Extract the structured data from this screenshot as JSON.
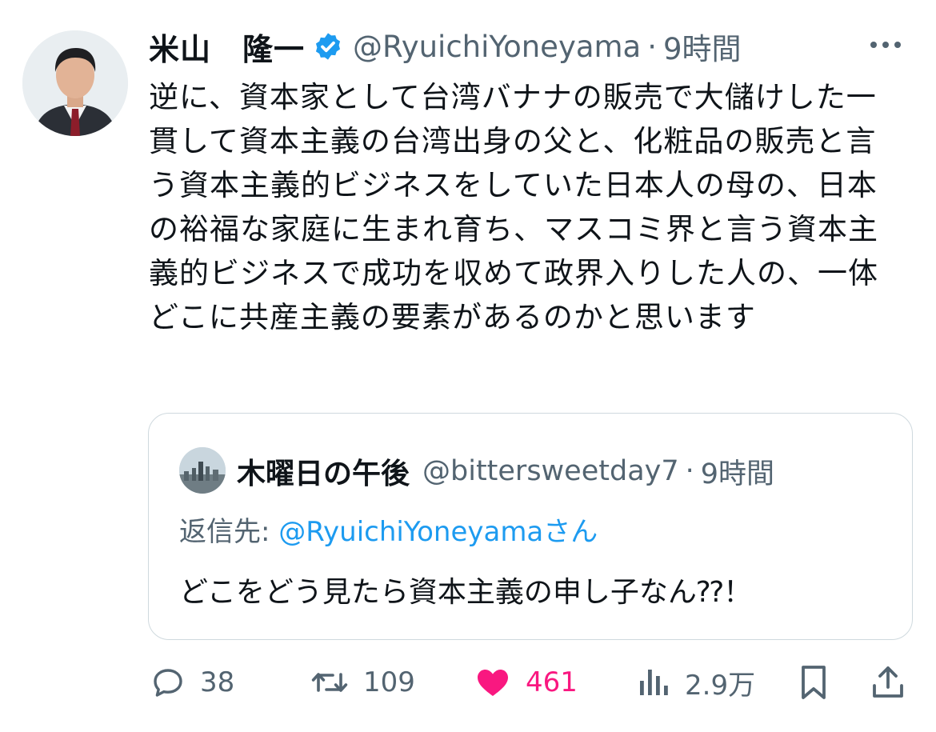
{
  "author": {
    "name": "米山　隆一",
    "handle": "@RyuichiYoneyama",
    "separator": "·",
    "time": "9時間"
  },
  "tweet": {
    "text": "逆に、資本家として台湾バナナの販売で大儲けした一貫して資本主義の台湾出身の父と、化粧品の販売と言う資本主義的ビジネスをしていた日本人の母の、日本の裕福な家庭に生まれ育ち、マスコミ界と言う資本主義的ビジネスで成功を収めて政界入りした人の、一体どこに共産主義の要素があるのかと思います"
  },
  "quote": {
    "name": "木曜日の午後",
    "handle": "@bittersweetday7",
    "separator": "·",
    "time": "9時間",
    "reply_prefix": "返信先: ",
    "reply_mention": "@RyuichiYoneyama",
    "reply_suffix": "さん",
    "text": "どこをどう見たら資本主義の申し子なん⁇！"
  },
  "actions": {
    "replies": "38",
    "retweets": "109",
    "likes": "461",
    "views": "2.9万"
  },
  "colors": {
    "verified": "#1d9bf0",
    "link": "#1d9bf0",
    "like": "#f91880",
    "secondary": "#536471",
    "text": "#0f1419",
    "border": "#cfd9de"
  },
  "icons": {
    "verified": "verified-badge-icon",
    "more": "more-options-icon",
    "reply": "reply-icon",
    "retweet": "retweet-icon",
    "like": "heart-icon",
    "views": "views-icon",
    "bookmark": "bookmark-icon",
    "share": "share-icon"
  }
}
